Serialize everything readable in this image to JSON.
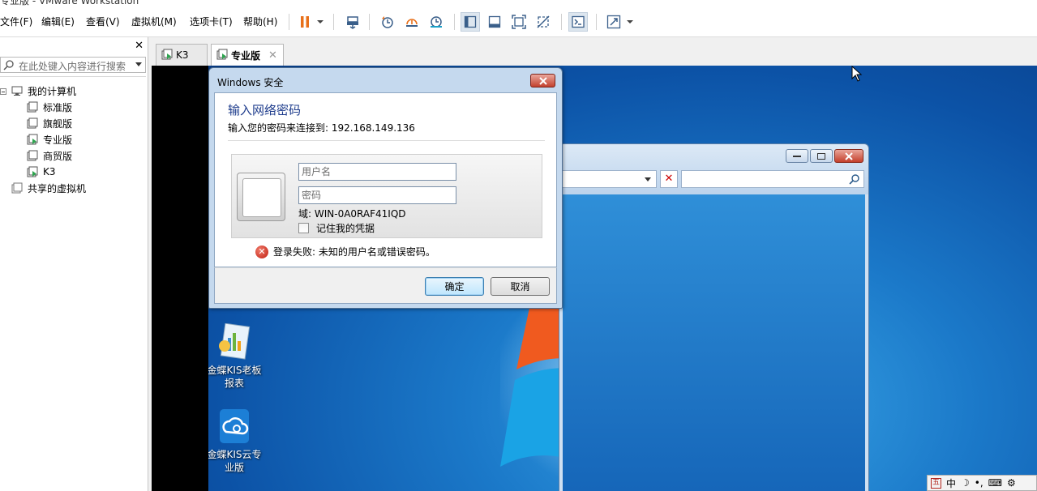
{
  "window": {
    "title": "专业版 - VMware Workstation"
  },
  "menu": {
    "file": "文件(F)",
    "edit": "编辑(E)",
    "view": "查看(V)",
    "vm": "虚拟机(M)",
    "tabs": "选项卡(T)",
    "help": "帮助(H)"
  },
  "library": {
    "search_placeholder": "在此处键入内容进行搜索",
    "root": "我的计算机",
    "vms": [
      "标准版",
      "旗舰版",
      "专业版",
      "商贸版",
      "K3"
    ],
    "shared": "共享的虚拟机"
  },
  "vm_tabs": [
    {
      "label": "K3"
    },
    {
      "label": "专业版"
    }
  ],
  "dialog": {
    "title": "Windows 安全",
    "heading": "输入网络密码",
    "subtitle": "输入您的密码来连接到: 192.168.149.136",
    "username_placeholder": "用户名",
    "username_value": "",
    "password_placeholder": "密码",
    "password_value": "",
    "domain_text": "域: WIN-0A0RAF41IQD",
    "remember_label": "记住我的凭据",
    "remember_checked": false,
    "error_text": "登录失败: 未知的用户名或错误密码。",
    "ok_label": "确定",
    "cancel_label": "取消"
  },
  "desktop_icons": [
    {
      "label_line1": "金蝶KIS老板",
      "label_line2": "报表"
    },
    {
      "label_line1": "金蝶KIS云专",
      "label_line2": "业版"
    }
  ],
  "tray": {
    "ime_mode": "中",
    "ime_badge": "五"
  },
  "colors": {
    "accent_pause": "#e8701a",
    "dialog_heading": "#1e3c8c",
    "close_red": "#c3412d",
    "error_red": "#c01f12"
  }
}
